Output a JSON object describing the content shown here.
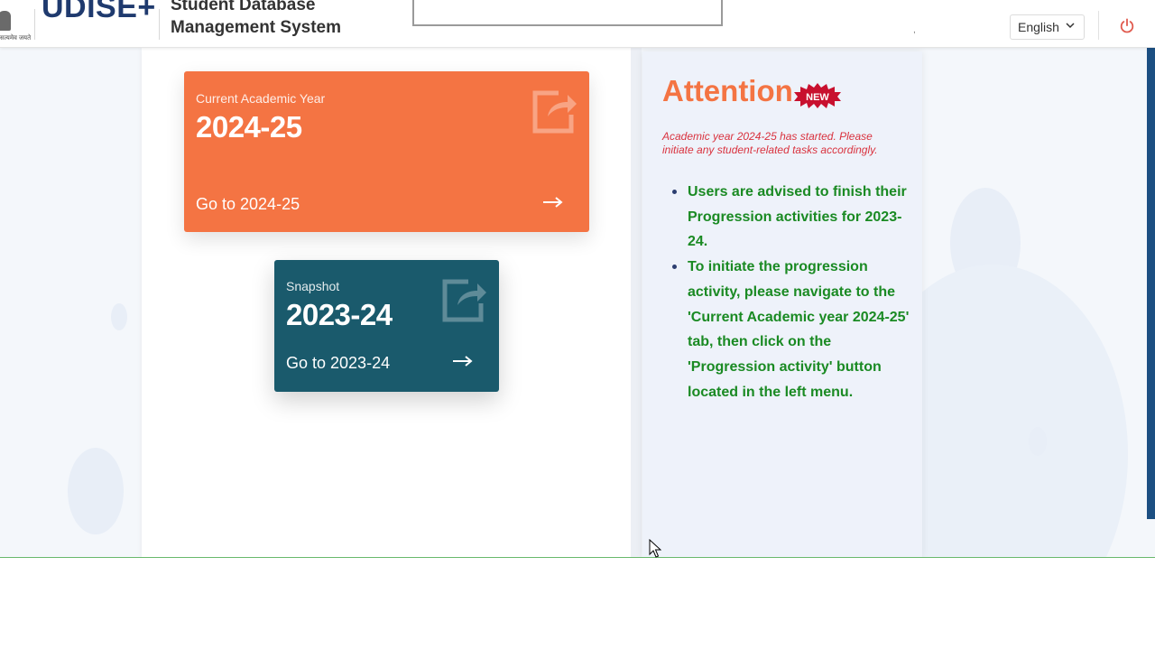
{
  "header": {
    "emblem_text": "सत्यमेव जयते",
    "logo_text": "UDISE+",
    "system_title_line1": "Student Database",
    "system_title_line2": "Management System",
    "language": "English",
    "dot_text": ","
  },
  "cards": {
    "current": {
      "label": "Current Academic Year",
      "year": "2024-25",
      "goto": "Go to 2024-25",
      "arrow": "→",
      "color": "#f47443"
    },
    "snapshot": {
      "label": "Snapshot",
      "year": "2023-24",
      "goto": "Go to 2023-24",
      "arrow": "→",
      "color": "#1a5a6c"
    }
  },
  "attention": {
    "title": "Attention",
    "badge": "NEW",
    "note": "Academic year 2024-25 has started. Please initiate any student-related tasks accordingly.",
    "items": [
      "Users are advised to finish their Progression activities for 2023-24.",
      "To initiate the progression activity, please navigate to the 'Current Academic year 2024-25' tab, then click on the 'Progression activity' button located in the left menu."
    ]
  },
  "icons": {
    "power": "power-icon",
    "share": "share-icon",
    "arrow": "arrow-right-icon",
    "chevron": "chevron-down-icon"
  },
  "colors": {
    "brand_blue": "#1f3a6e",
    "orange": "#f47443",
    "teal": "#1a5a6c",
    "attention_green": "#1a8a23",
    "note_red": "#d9323e"
  }
}
